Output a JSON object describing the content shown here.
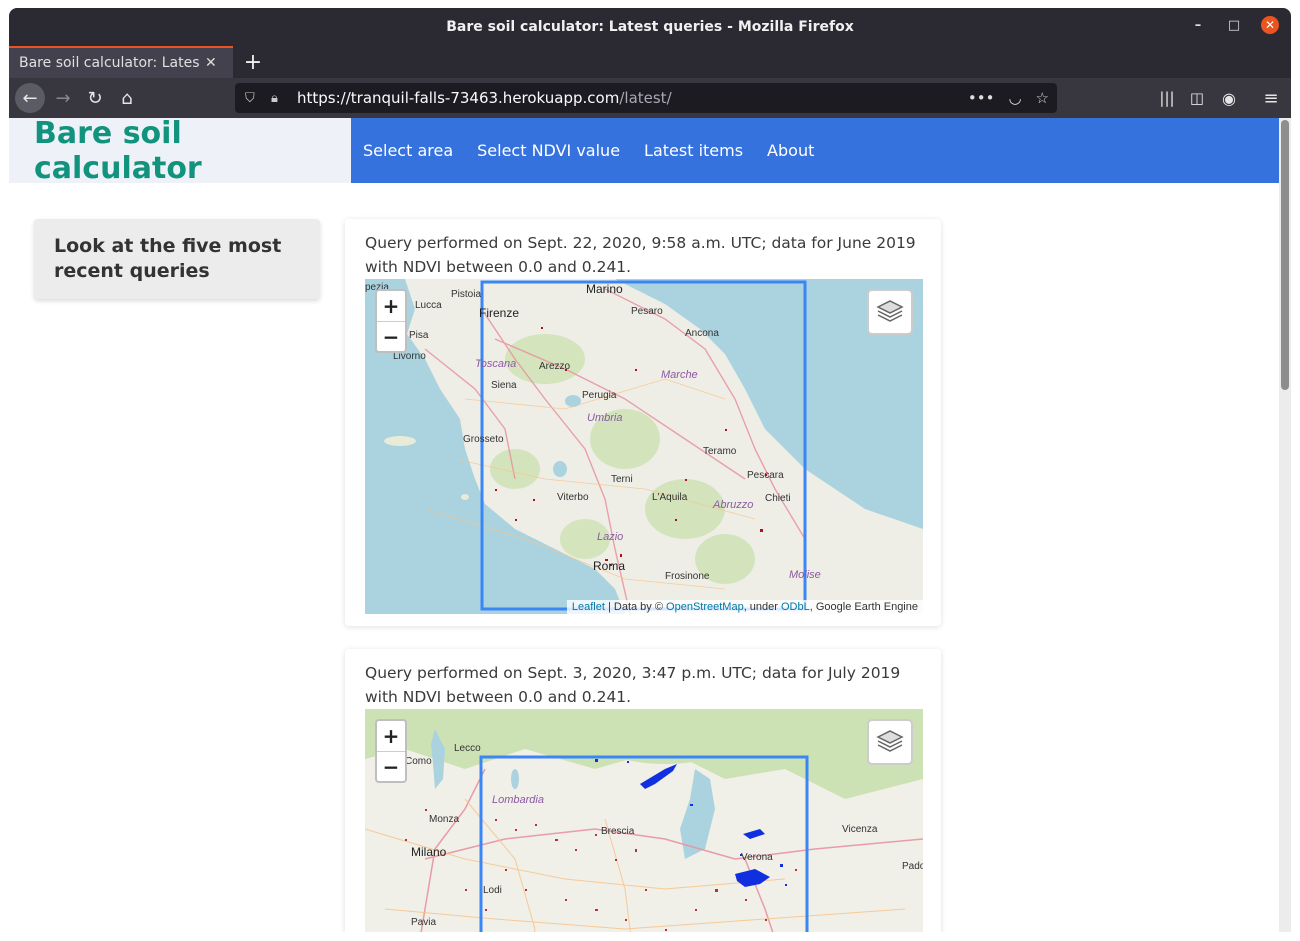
{
  "browser": {
    "window_title": "Bare soil calculator: Latest queries - Mozilla Firefox",
    "tab_title": "Bare soil calculator: Latest queries",
    "url_host": "https://tranquil-falls-73463.herokuapp.com",
    "url_path": "/latest/"
  },
  "site": {
    "brand": "Bare soil calculator",
    "nav": [
      "Select area",
      "Select NDVI value",
      "Latest items",
      "About"
    ]
  },
  "sidebar": {
    "heading": "Look at the five most recent queries"
  },
  "queries": [
    {
      "text": "Query performed on Sept. 22, 2020, 9:58 a.m. UTC; data for June 2019 with NDVI between 0.0 and 0.241.",
      "places": [
        "Marino",
        "Pistoia",
        "Lucca",
        "Firenze",
        "Pesaro",
        "Ancona",
        "Pisa",
        "Livorno",
        "Toscana",
        "Arezzo",
        "Marche",
        "Siena",
        "Perugia",
        "Umbria",
        "Grosseto",
        "Teramo",
        "Pescara",
        "Terni",
        "Chieti",
        "Viterbo",
        "L'Aquila",
        "Abruzzo",
        "Lazio",
        "Roma",
        "Frosinone",
        "Molise"
      ]
    },
    {
      "text": "Query performed on Sept. 3, 2020, 3:47 p.m. UTC; data for July 2019 with NDVI between 0.0 and 0.241.",
      "places": [
        "Lecco",
        "Como",
        "Lombardia",
        "Monza",
        "Brescia",
        "Vicenza",
        "Milano",
        "Verona",
        "Padova",
        "Lodi",
        "Pavia"
      ]
    }
  ],
  "map_controls": {
    "zoom_in": "+",
    "zoom_out": "−",
    "layers_icon": "layers-icon"
  },
  "attribution": {
    "leaflet": "Leaflet",
    "sep": " | Data by © ",
    "osm": "OpenStreetMap",
    "under": ", under ",
    "odbl": "ODbL",
    "gee": ", Google Earth Engine"
  },
  "colors": {
    "brand": "#12937e",
    "nav": "#3572de",
    "bbox": "#3b86f5",
    "bare_soil": "#c0101a",
    "water_mask": "#1030e0"
  }
}
